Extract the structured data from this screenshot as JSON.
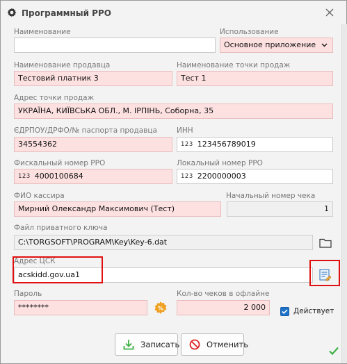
{
  "window": {
    "title": "Программный РРО",
    "title_icon": "gear-icon",
    "close_icon": "close-icon"
  },
  "fields": {
    "name": {
      "label": "Наименование",
      "value": ""
    },
    "usage": {
      "label": "Использование",
      "value": "Основное приложение",
      "icon": "chevron-down-icon"
    },
    "seller_name": {
      "label": "Наименование продавца",
      "value": "Тестовий платник 3"
    },
    "point_name": {
      "label": "Наименование точки продаж",
      "value": "Тест 1"
    },
    "point_address": {
      "label": "Адрес точки продаж",
      "value": "УКРАЇНА, КИЇВСЬКА ОБЛ., М. ІРПІНЬ, Соборна, 35"
    },
    "edrpou": {
      "label": "ЄДРПОУ/ДРФО/№ паспорта продавца",
      "value": "34554362"
    },
    "inn": {
      "label": "ИНН",
      "prefix": "123",
      "value": "123456789019"
    },
    "fiscal_number": {
      "label": "Фискальный номер РРО",
      "prefix": "123",
      "value": "4000100684"
    },
    "local_number": {
      "label": "Локальный номер РРО",
      "prefix": "123",
      "value": "2200000003"
    },
    "cashier": {
      "label": "ФИО кассира",
      "value": "Мирний Олександр Максимович (Тест)"
    },
    "start_check": {
      "label": "Начальный номер чека",
      "value": "1"
    },
    "key_file": {
      "label": "Файл приватного ключа",
      "value": "C:\\TORGSOFT\\PROGRAM\\Key\\Key-6.dat",
      "icon": "folder-icon"
    },
    "csk_address": {
      "label": "Адрес ЦСК",
      "value": "acskidd.gov.ua1",
      "icon": "edit-list-icon"
    },
    "password": {
      "label": "Пароль",
      "value": "********",
      "icon": "password-generate-icon"
    },
    "offline_checks": {
      "label": "Кол-во чеков в офлайне",
      "value": "2 000"
    },
    "active": {
      "label": "Действует",
      "checked": true
    }
  },
  "buttons": {
    "save": {
      "label": "Записать",
      "icon": "save-download-icon"
    },
    "cancel": {
      "label": "Отменить",
      "icon": "cancel-icon"
    },
    "ok_icon": "checkmark-icon"
  },
  "colors": {
    "required_field": "#fde0e0",
    "highlight": "#e01010",
    "checkbox": "#1e72c9",
    "ok_green": "#3cb043"
  }
}
